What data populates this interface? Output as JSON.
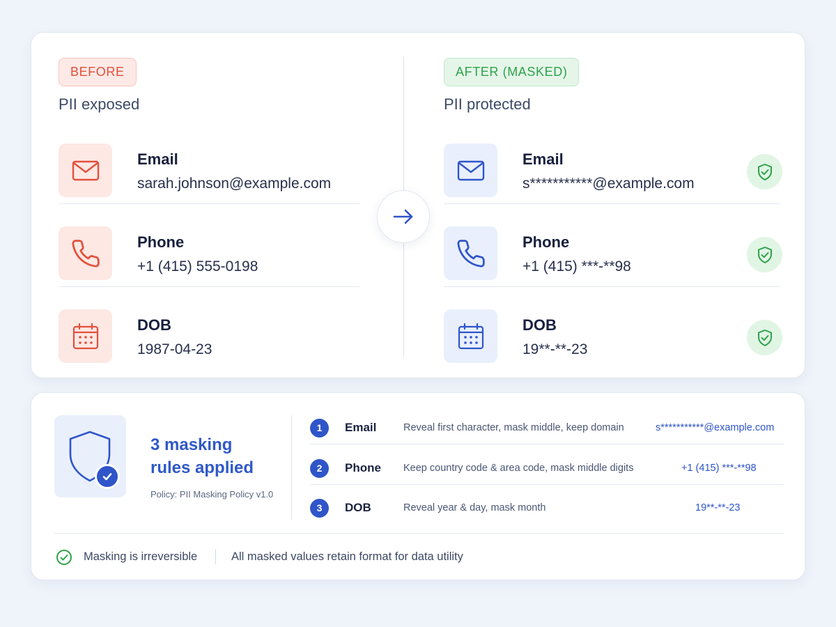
{
  "before": {
    "badge": "BEFORE",
    "subtitle": "PII exposed",
    "accent": "#e2513c",
    "fields": [
      {
        "label": "Email",
        "value": "sarah.johnson@example.com",
        "icon": "mail-icon"
      },
      {
        "label": "Phone",
        "value": "+1 (415) 555-0198",
        "icon": "phone-icon"
      },
      {
        "label": "DOB",
        "value": "1987-04-23",
        "icon": "calendar-icon"
      }
    ]
  },
  "after": {
    "badge": "AFTER (MASKED)",
    "subtitle": "PII protected",
    "accent": "#2f55c9",
    "status_color": "#2ea24a",
    "fields": [
      {
        "label": "Email",
        "value": "s***********@example.com",
        "icon": "mail-icon",
        "status_icon": "shield-check-icon"
      },
      {
        "label": "Phone",
        "value": "+1 (415) ***-**98",
        "icon": "phone-icon",
        "status_icon": "shield-check-icon"
      },
      {
        "label": "DOB",
        "value": "19**-**-23",
        "icon": "calendar-icon",
        "status_icon": "shield-check-icon"
      }
    ]
  },
  "transform_icon": "arrow-right-icon",
  "summary": {
    "title": "3 masking rules applied",
    "policy": "Policy: PII Masking Policy v1.0",
    "icon": "shield-check-icon",
    "rules": [
      {
        "number": "1",
        "name": "Email",
        "description": "Reveal first character, mask middle, keep domain",
        "result": "s***********@example.com"
      },
      {
        "number": "2",
        "name": "Phone",
        "description": "Keep country code & area code, mask middle digits",
        "result": "+1 (415) ***-**98"
      },
      {
        "number": "3",
        "name": "DOB",
        "description": "Reveal year & day, mask month",
        "result": "19**-**-23"
      }
    ]
  },
  "footer": {
    "note1": "Masking is irreversible",
    "note2": "All masked values retain format for data utility",
    "icon": "check-circle-icon"
  }
}
